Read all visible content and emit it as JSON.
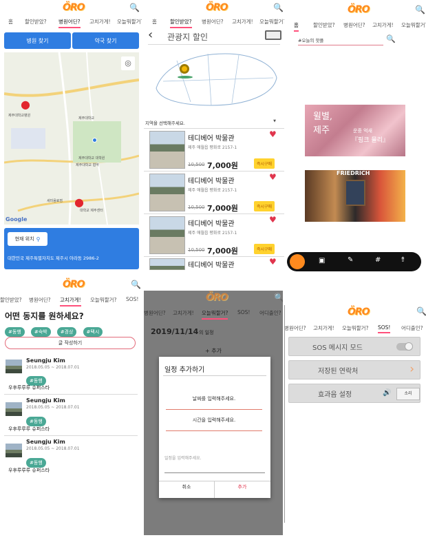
{
  "brand": {
    "logo": "ÖRO",
    "accent": "#ff4f7a",
    "logo_color": "#ff8a1e",
    "blue": "#2f7de1",
    "teal": "#4aa895"
  },
  "p1": {
    "tabs": [
      "홈",
      "할인받았?",
      "병원어딘?",
      "고치가게!",
      "오늘뭐할거?"
    ],
    "active_tab": "병원어딘?",
    "hospital_btn": "병원 찾기",
    "pharmacy_btn": "약국 찾기",
    "map_labels": [
      "제주대학교병원",
      "제주대학교",
      "제주대학교 대학원",
      "제주대학교 협약",
      "세미음료점",
      "대학교 제주센터"
    ],
    "google": "Google",
    "location_btn": "현재 위치",
    "address": "대한민국 제주특별자치도 제주시 아라동 2986-2"
  },
  "p2": {
    "tabs": [
      "홈",
      "할인받았?",
      "병원어딘?",
      "고치가게!",
      "오늘뭐할거?"
    ],
    "active_tab": "할인받았?",
    "title": "관광지 할인",
    "region_prompt": "지역을 선택해주세요.",
    "items": [
      {
        "name": "테디베어 박물관",
        "addr": "제주 애월읍 평화로 2157-1",
        "old": "10,500",
        "price": "7,000원",
        "buy": "즉시구매"
      },
      {
        "name": "테디베어 박물관",
        "addr": "제주 애월읍 평화로 2157-1",
        "old": "10,500",
        "price": "7,000원",
        "buy": "즉시구매"
      },
      {
        "name": "테디베어 박물관",
        "addr": "제주 애월읍 평화로 2157-1",
        "old": "10,500",
        "price": "7,000원",
        "buy": "즉시구매"
      },
      {
        "name": "테디베어 박물관"
      }
    ]
  },
  "p3": {
    "tabs": [
      "홈",
      "할인받았?",
      "병원어딘?",
      "고치가게!",
      "오늘뭐할거?"
    ],
    "active_tab": "홈",
    "search_tag": "#오늘의 핫플",
    "card1_line1": "윌별,",
    "card1_line2": "제주",
    "card1_sub": "운중 억새",
    "card1_title": "『핑크 뮬리』",
    "card2_text": "FRIEDRICH"
  },
  "p4": {
    "tabs": [
      "할인받았?",
      "병원어딘?",
      "고치가게!",
      "오늘뭐할거?",
      "SOS!"
    ],
    "active_tab": "고치가게!",
    "question": "어떤 동지를 원하세요?",
    "chips": [
      "#동행",
      "#숙박",
      "#경상",
      "#택시"
    ],
    "write_btn": "글 작성하기",
    "posts": [
      {
        "name": "Seungju Kim",
        "date": "2018.05.05 ~ 2018.07.01",
        "tag": "#동행",
        "text": "우후루루루 슈퍼스타"
      },
      {
        "name": "Seungju Kim",
        "date": "2018.05.05 ~ 2018.07.01",
        "tag": "#동행",
        "text": "우후루루루 슈퍼스타"
      },
      {
        "name": "Seungju Kim",
        "date": "2018.05.05 ~ 2018.07.01",
        "tag": "#동행",
        "text": "우후루루루 슈퍼스타"
      }
    ]
  },
  "p5": {
    "tabs": [
      "병원어딘?",
      "고치가게!",
      "오늘뭐할거?",
      "SOS!",
      "어디출인?"
    ],
    "active_tab": "오늘뭐할거?",
    "date": "2019/11/14",
    "date_suffix": "의 일정",
    "add_bg": "+ 추가",
    "modal_title": "일정 추가하기",
    "date_field": "날짜를 입력해주세요.",
    "time_field": "시간을 입력해주세요.",
    "memo_placeholder": "일정을 입력해주세요.",
    "cancel": "취소",
    "add": "추가"
  },
  "p6": {
    "tabs": [
      "병원어딘?",
      "고치가게!",
      "오늘뭐할거?",
      "SOS!",
      "어디출인?"
    ],
    "active_tab": "SOS!",
    "sos_mode": "SOS 메시지 모드",
    "saved_contacts": "저장된 연락처",
    "sound_setting": "효과음 설정",
    "sound_value": "소리"
  }
}
